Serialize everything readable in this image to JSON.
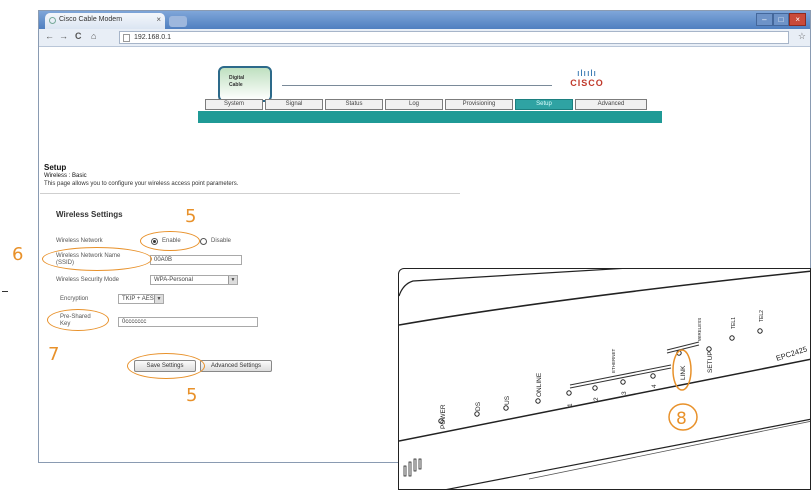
{
  "browser": {
    "tab_title": "Cisco Cable Modem",
    "tab_close": "×",
    "address": "192.168.0.1",
    "nav_back": "←",
    "nav_forward": "→",
    "nav_reload": "C",
    "nav_home": "⌂",
    "star": "☆",
    "window_min": "–",
    "window_max": "□",
    "window_close": "×"
  },
  "header": {
    "logo_text_1": "Digital",
    "logo_text_2": "Cable",
    "cisco_bars": "ılıılı",
    "cisco_word": "CISCO",
    "tabs": [
      {
        "label": "System",
        "active": false
      },
      {
        "label": "Signal",
        "active": false
      },
      {
        "label": "Status",
        "active": false
      },
      {
        "label": "Log",
        "active": false
      },
      {
        "label": "Provisioning",
        "active": false
      },
      {
        "label": "Setup",
        "active": true
      },
      {
        "label": "Advanced",
        "active": false
      }
    ],
    "accent_color": "#1f9a96"
  },
  "setup": {
    "title": "Setup",
    "crumb": "Wireless : Basic",
    "description": "This page allows you to configure your wireless access point parameters."
  },
  "wireless_settings": {
    "title": "Wireless Settings",
    "network_label": "Wireless Network",
    "enable_label": "Enable",
    "disable_label": "Disable",
    "network_enabled": true,
    "ssid_label_1": "Wireless Network Name",
    "ssid_label_2": "(SSID)",
    "ssid_value": "00A0B",
    "security_label": "Wireless Security Mode",
    "security_value": "WPA-Personal",
    "encryption_label": "Encryption",
    "encryption_value": "TKIP + AES",
    "psk_label_1": "Pre-Shared",
    "psk_label_2": "Key",
    "psk_value": "0ccccccc",
    "save_label": "Save Settings",
    "advanced_label": "Advanced Settings"
  },
  "callouts": {
    "enable": "5",
    "ssid": "6",
    "psk": "7",
    "save": "5",
    "link": "8",
    "color": "#e8912a"
  },
  "device": {
    "model": "EPC2425",
    "power": "POWER",
    "ds": "DS",
    "us": "US",
    "online": "ONLINE",
    "ethernet": "ETHERNET",
    "port_1": "1",
    "port_2": "2",
    "port_3": "3",
    "port_4": "4",
    "link": "LINK",
    "wireless": "WIRELESS",
    "setup": "SETUP",
    "tel1": "TEL1",
    "tel2": "TEL2"
  }
}
